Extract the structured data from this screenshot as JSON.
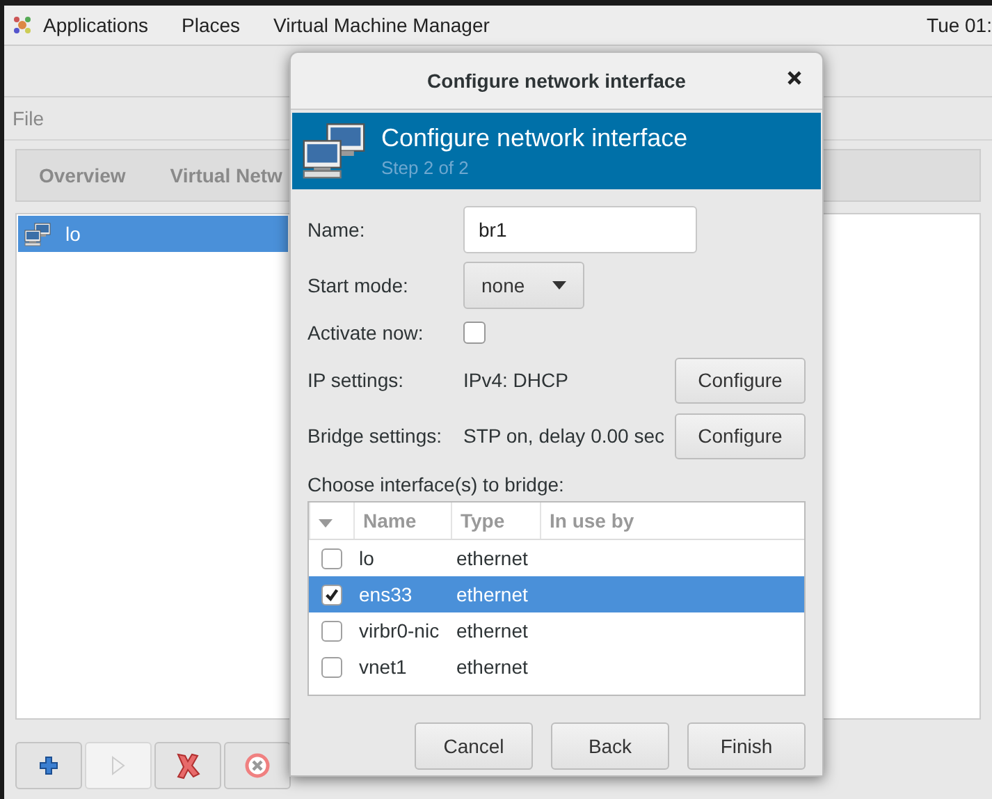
{
  "top_panel": {
    "menus": [
      "Applications",
      "Places",
      "Virtual Machine Manager"
    ],
    "clock": "Tue 01:"
  },
  "main_window": {
    "menu": [
      "File"
    ],
    "tabs": [
      "Overview",
      "Virtual Netw"
    ],
    "interfaces": [
      {
        "name": "lo",
        "selected": true
      }
    ],
    "toolbar": [
      {
        "kind": "add",
        "disabled": false
      },
      {
        "kind": "start",
        "disabled": true
      },
      {
        "kind": "delete",
        "disabled": false
      },
      {
        "kind": "stop",
        "disabled": false
      }
    ]
  },
  "dialog": {
    "title": "Configure network interface",
    "banner_title": "Configure network interface",
    "banner_subtitle": "Step 2 of 2",
    "fields": [
      {
        "kind": "entry",
        "label": "Name:",
        "value": "br1"
      },
      {
        "kind": "combo",
        "label": "Start mode:",
        "value": "none"
      },
      {
        "kind": "checkbox",
        "label": "Activate now:",
        "checked": false
      },
      {
        "kind": "info",
        "label": "IP settings:",
        "value": "IPv4: DHCP",
        "button": "Configure"
      },
      {
        "kind": "info",
        "label": "Bridge settings:",
        "value": "STP on, delay 0.00 sec",
        "button": "Configure"
      }
    ],
    "bridge_label": "Choose interface(s) to bridge:",
    "columns": [
      "Name",
      "Type",
      "In use by"
    ],
    "rows": [
      {
        "name": "lo",
        "type": "ethernet",
        "checked": false,
        "selected": false
      },
      {
        "name": "ens33",
        "type": "ethernet",
        "checked": true,
        "selected": true
      },
      {
        "name": "virbr0-nic",
        "type": "ethernet",
        "checked": false,
        "selected": false
      },
      {
        "name": "vnet1",
        "type": "ethernet",
        "checked": false,
        "selected": false
      }
    ],
    "buttons": [
      "Cancel",
      "Back",
      "Finish"
    ]
  }
}
